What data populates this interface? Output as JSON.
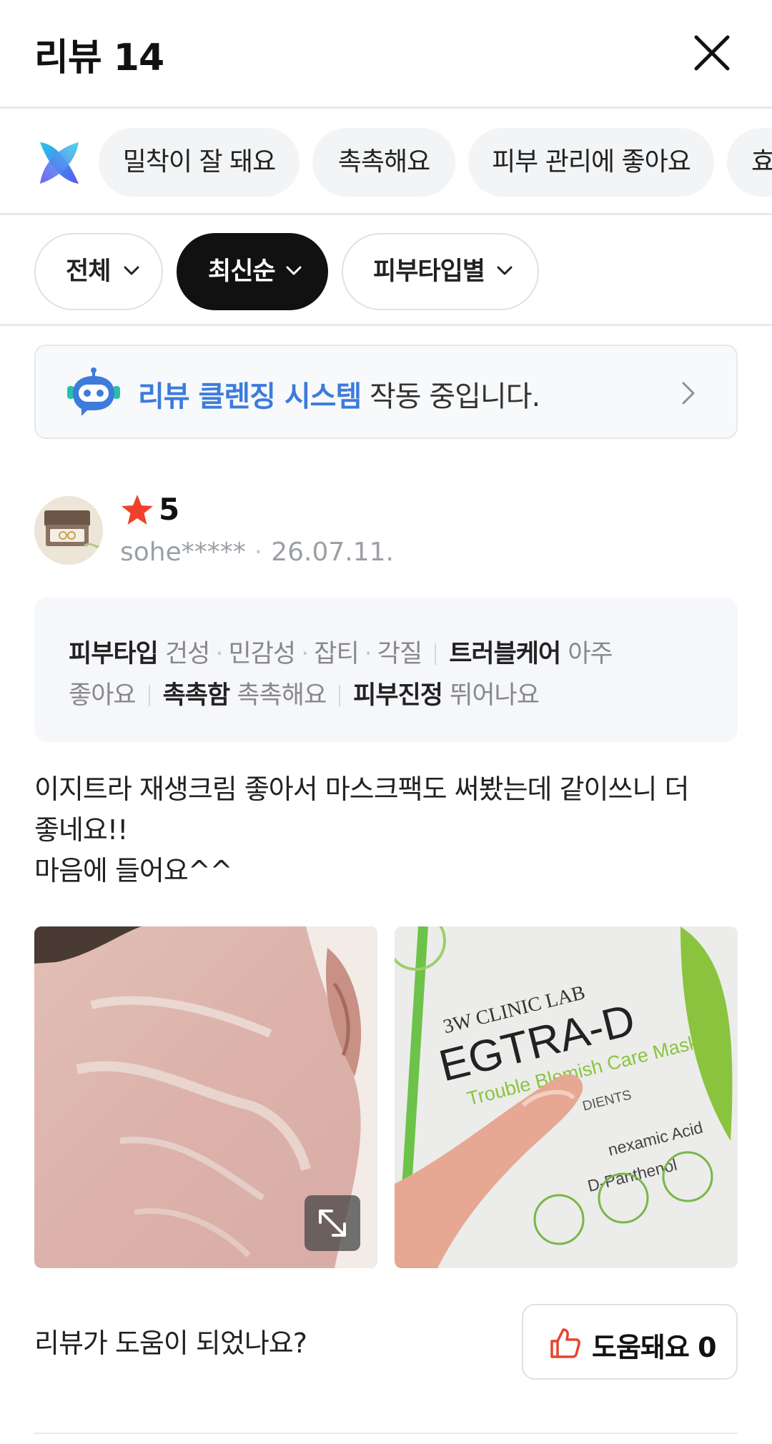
{
  "header": {
    "title": "리뷰 14"
  },
  "keywords": [
    "밀착이 잘 돼요",
    "촉촉해요",
    "피부 관리에 좋아요",
    "효"
  ],
  "filters": [
    {
      "label": "전체",
      "active": false
    },
    {
      "label": "최신순",
      "active": true
    },
    {
      "label": "피부타입별",
      "active": false
    }
  ],
  "cleansing": {
    "highlight": "리뷰 클렌징 시스템",
    "rest": " 작동 중입니다."
  },
  "review": {
    "rating": "5",
    "reviewer": "sohe*****",
    "date": "26.07.11.",
    "attributes": {
      "skin_type_label": "피부타입",
      "skin_types": [
        "건성",
        "민감성",
        "잡티",
        "각질"
      ],
      "trouble_label": "트러블케어",
      "trouble_value_1": "아주",
      "trouble_value_2": "좋아요",
      "moist_label": "촉촉함",
      "moist_value": "촉촉해요",
      "soothe_label": "피부진정",
      "soothe_value": "뛰어나요"
    },
    "text_lines": [
      "이지트라 재생크림 좋아서 마스크팩도 써봤는데 같이쓰니 더",
      "좋네요!!",
      "마음에 들어요^^"
    ],
    "photo_text": {
      "brand": "3W CLINIC LAB",
      "product": "EGTRA-D",
      "subtitle": "Trouble Blemish Care Mask",
      "ingredients_partial": "DIENTS",
      "ingredient_1": "nexamic Acid",
      "ingredient_2": "D-Panthenol"
    }
  },
  "helpful": {
    "question": "리뷰가 도움이 되었나요?",
    "button_label": "도움돼요 0"
  },
  "colors": {
    "accent_blue": "#3d7bdc",
    "star_red": "#f0412b",
    "thumb_red": "#e8432f",
    "active_filter": "#111111"
  }
}
